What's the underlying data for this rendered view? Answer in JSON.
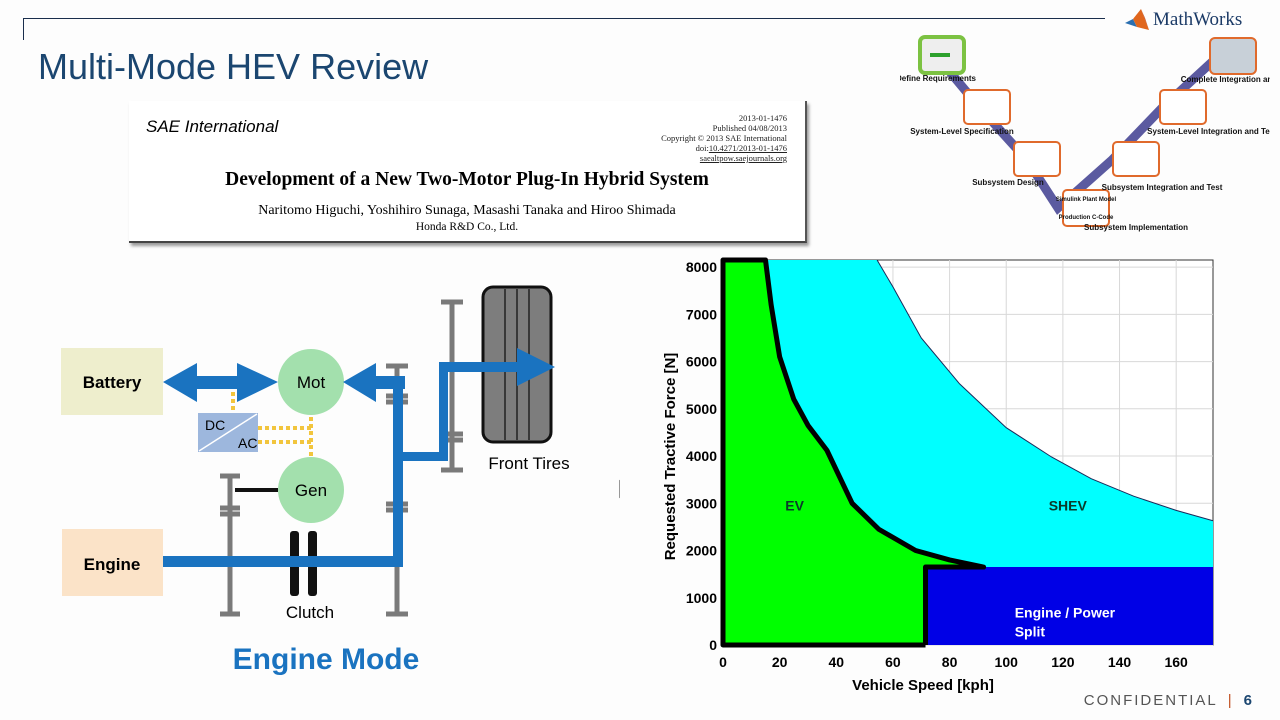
{
  "slide": {
    "title": "Multi-Mode HEV Review",
    "logo_text": "MathWorks",
    "footer_label": "CONFIDENTIAL",
    "footer_separator": "|",
    "page_number": "6"
  },
  "paper": {
    "publisher_logo": "SAE International",
    "paper_number": "2013-01-1476",
    "published": "Published 04/08/2013",
    "copyright": "Copyright © 2013 SAE International",
    "doi_prefix": "doi:",
    "doi": "10.4271/2013-01-1476",
    "site": "saealtpow.saejournals.org",
    "title": "Development of a New Two-Motor Plug-In Hybrid System",
    "authors": "Naritomo Higuchi, Yoshihiro Sunaga, Masashi Tanaka  and  Hiroo Shimada",
    "organization": "Honda R&D Co., Ltd."
  },
  "v_diagram": {
    "stages": [
      {
        "label": "Define Requirements"
      },
      {
        "label": "System-Level Specification"
      },
      {
        "label": "Subsystem Design"
      },
      {
        "label": "Subsystem Implementation",
        "box_lines": [
          "Simulink Plant Model",
          "Production C-Code"
        ]
      },
      {
        "label": "Subsystem Integration and Test"
      },
      {
        "label": "System-Level Integration and Test"
      },
      {
        "label": "Complete Integration and Test"
      }
    ],
    "path_color": "#5b5aa0",
    "box_border_color": "#e06a2c",
    "highlight_color": "#7cc242"
  },
  "powertrain": {
    "battery": "Battery",
    "engine": "Engine",
    "motor": "Mot",
    "generator": "Gen",
    "converter_dc": "DC",
    "converter_ac": "AC",
    "front_tires": "Front Tires",
    "clutch": "Clutch",
    "mode_title": "Engine Mode",
    "colors": {
      "flow": "#1a73c0",
      "machine": "#a3e0ad",
      "battery": "#eeeecd",
      "engine": "#fbe3c8",
      "converter": "#9db7dd",
      "electric_link": "#f2c53d"
    }
  },
  "chart_data": {
    "type": "area",
    "title": "",
    "xlabel": "Vehicle Speed [kph]",
    "ylabel": "Requested Tractive Force [N]",
    "xlim": [
      0,
      173
    ],
    "ylim": [
      0,
      8150
    ],
    "xticks": [
      0,
      20,
      40,
      60,
      80,
      100,
      120,
      140,
      160
    ],
    "yticks": [
      0,
      1000,
      2000,
      3000,
      4000,
      5000,
      6000,
      7000,
      8000
    ],
    "grid": true,
    "regions": [
      {
        "name": "EV",
        "label": "EV",
        "color": "#00ff00",
        "label_at": [
          22,
          2850
        ]
      },
      {
        "name": "SHEV",
        "label": "SHEV",
        "color": "#00ffff",
        "label_at": [
          115,
          2850
        ]
      },
      {
        "name": "Engine / Power Split",
        "label_lines": [
          "Engine / Power",
          "Split"
        ],
        "color": "#0000e6",
        "label_at": [
          103,
          580
        ]
      }
    ],
    "ev_boundary": [
      [
        15,
        8150
      ],
      [
        17,
        7200
      ],
      [
        20,
        6100
      ],
      [
        25,
        5200
      ],
      [
        30,
        4650
      ],
      [
        36.7,
        4120
      ],
      [
        45.6,
        3000
      ],
      [
        55,
        2450
      ],
      [
        68,
        2000
      ],
      [
        80,
        1800
      ],
      [
        92,
        1650
      ]
    ],
    "shev_boundary": [
      [
        54.4,
        8150
      ],
      [
        60,
        7580
      ],
      [
        70,
        6500
      ],
      [
        83.5,
        5530
      ],
      [
        100,
        4600
      ],
      [
        116,
        3980
      ],
      [
        130,
        3520
      ],
      [
        145,
        3150
      ],
      [
        160,
        2850
      ],
      [
        173,
        2630
      ]
    ],
    "engine_region": {
      "speed_min": 71.5,
      "force_max": 1650
    }
  }
}
